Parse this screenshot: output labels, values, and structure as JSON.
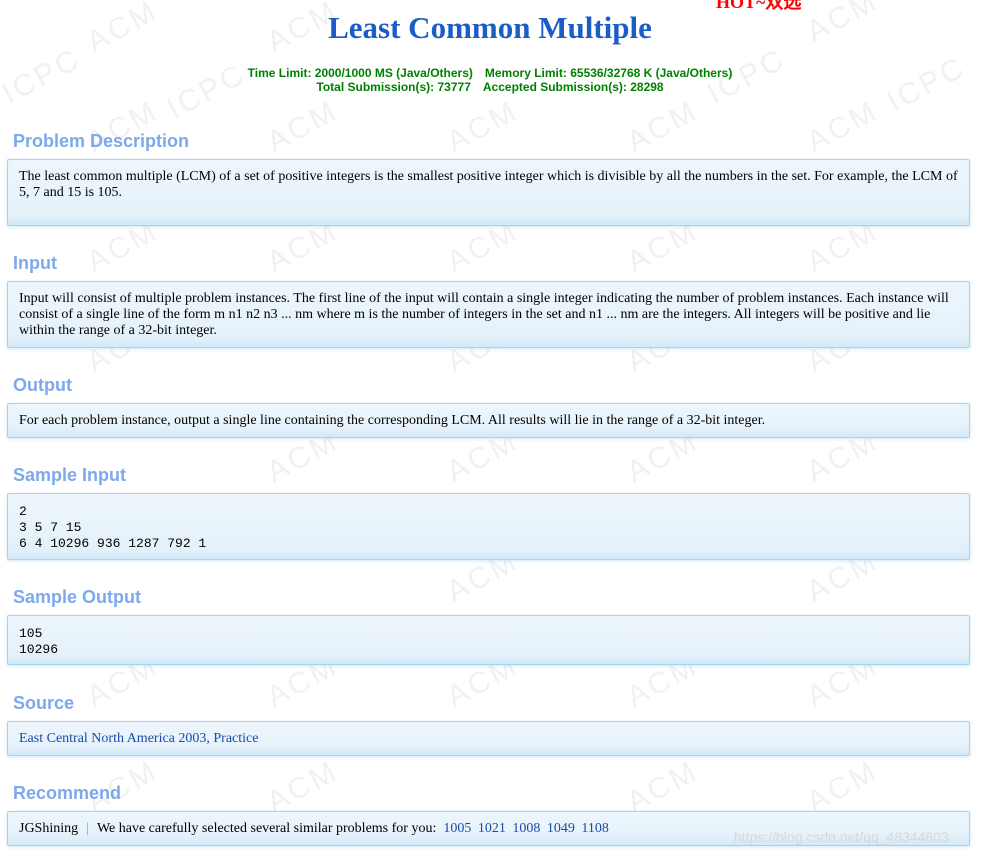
{
  "hot_badge": "HOT~双选",
  "title": "Least Common Multiple",
  "limits": {
    "time_limit": "Time Limit: 2000/1000 MS (Java/Others)",
    "memory_limit": "Memory Limit: 65536/32768 K (Java/Others)",
    "total_submissions": "Total Submission(s): 73777",
    "accepted_submissions": "Accepted Submission(s): 28298"
  },
  "sections": {
    "description": {
      "title": "Problem Description",
      "text": "The least common multiple (LCM) of a set of positive integers is the smallest positive integer which is divisible by all the numbers in the set. For example, the LCM of 5, 7 and 15 is 105."
    },
    "input": {
      "title": "Input",
      "text": "Input will consist of multiple problem instances. The first line of the input will contain a single integer indicating the number of problem instances. Each instance will consist of a single line of the form m n1 n2 n3 ... nm where m is the number of integers in the set and n1 ... nm are the integers. All integers will be positive and lie within the range of a 32-bit integer."
    },
    "output": {
      "title": "Output",
      "text": "For each problem instance, output a single line containing the corresponding LCM. All results will lie in the range of a 32-bit integer."
    },
    "sample_input": {
      "title": "Sample Input",
      "text": "2\n3 5 7 15\n6 4 10296 936 1287 792 1"
    },
    "sample_output": {
      "title": "Sample Output",
      "text": "105\n10296"
    },
    "source": {
      "title": "Source",
      "link_text": "East Central North America 2003, Practice"
    },
    "recommend": {
      "title": "Recommend",
      "author": "JGShining",
      "separator": "|",
      "message": "We have carefully selected several similar problems for you:",
      "problems": [
        "1005",
        "1021",
        "1008",
        "1049",
        "1108"
      ]
    }
  },
  "watermark_url": "https://blog.csdn.net/qq_48344603",
  "background_watermark_text": "ACM ICPC",
  "colors": {
    "title": "#1a5cc8",
    "section_title": "#7ca9ed",
    "limits": "#008000",
    "hot_badge": "#ff0000",
    "panel_border": "#9fd7f0",
    "panel_background": "#eef6fc",
    "link": "#1a4aa8"
  }
}
